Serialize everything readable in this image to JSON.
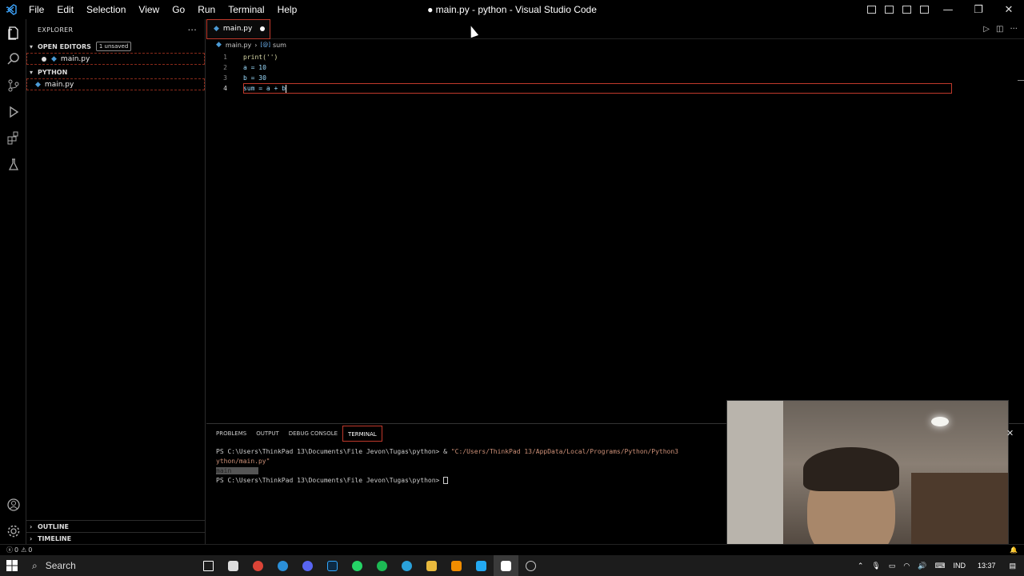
{
  "window": {
    "title": "● main.py - python - Visual Studio Code"
  },
  "menu": [
    "File",
    "Edit",
    "Selection",
    "View",
    "Go",
    "Run",
    "Terminal",
    "Help"
  ],
  "sidebar": {
    "header": "EXPLORER",
    "more": "···",
    "open_editors_label": "OPEN EDITORS",
    "unsaved_badge": "1 unsaved",
    "open_editor_file": "main.py",
    "folder_label": "PYTHON",
    "folder_file": "main.py",
    "outline_label": "OUTLINE",
    "timeline_label": "TIMELINE"
  },
  "editor": {
    "tab_label": "main.py",
    "breadcrumb_file": "main.py",
    "breadcrumb_symbol": "sum",
    "lines": [
      {
        "num": "1",
        "text": "print('')"
      },
      {
        "num": "2",
        "text": "a = 10"
      },
      {
        "num": "3",
        "text": "b = 30"
      },
      {
        "num": "4",
        "text": "sum = a + b"
      }
    ]
  },
  "panel": {
    "tabs": [
      "PROBLEMS",
      "OUTPUT",
      "DEBUG CONSOLE",
      "TERMINAL"
    ],
    "active_tab": "TERMINAL",
    "terminal_lines": {
      "l1_prompt": "PS C:\\Users\\ThinkPad 13\\Documents\\File Jevon\\Tugas\\python> & ",
      "l1_path": "\"C:/Users/ThinkPad 13/AppData/Local/Programs/Python/Python3",
      "l2": "ython/main.py\"",
      "l3": "main",
      "l4_prompt": "PS C:\\Users\\ThinkPad 13\\Documents\\File Jevon\\Tugas\\python> "
    }
  },
  "status": {
    "errors": "0",
    "warnings": "0"
  },
  "taskbar": {
    "search_label": "Search",
    "lang": "IND",
    "time": "13:37"
  },
  "colors": {
    "accent_red": "#c0392b",
    "python_blue": "#4b9bd6",
    "string_orange": "#ce9178"
  }
}
